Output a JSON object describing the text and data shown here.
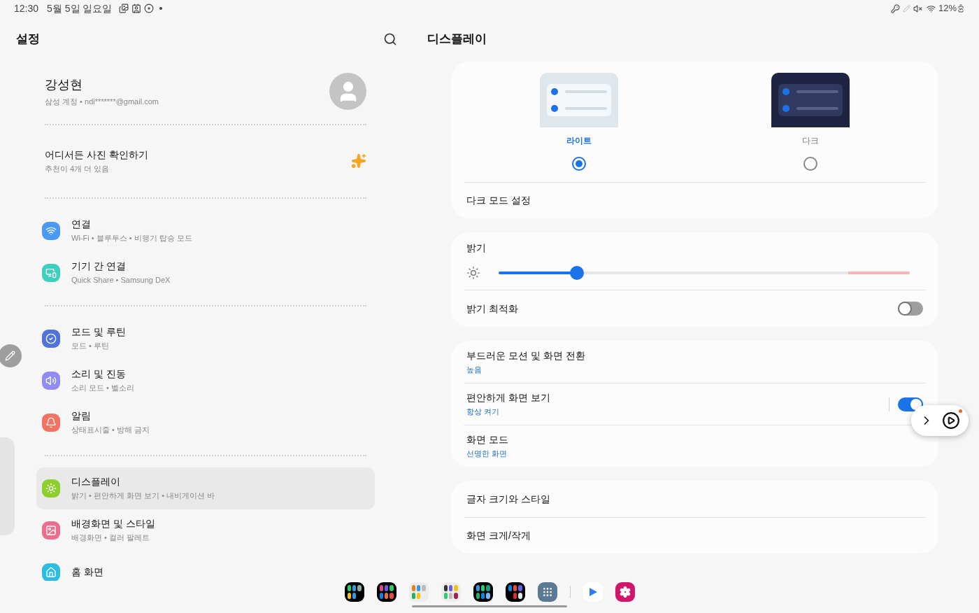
{
  "status_bar": {
    "time": "12:30",
    "date": "5월 5일 일요일",
    "battery": "12%"
  },
  "settings": {
    "title": "설정",
    "account": {
      "name": "강성현",
      "detail": "삼성 계정 • ndi*******@gmail.com"
    },
    "suggestion": {
      "title": "어디서든 사진 확인하기",
      "subtitle": "추천이 4개 더 있음"
    },
    "groups": [
      [
        {
          "title": "연결",
          "subtitle": "Wi-Fi • 블루투스 • 비행기 탑승 모드",
          "color": "#4a9af5",
          "selected": false
        },
        {
          "title": "기기 간 연결",
          "subtitle": "Quick Share • Samsung DeX",
          "color": "#3fcfc0",
          "selected": false
        }
      ],
      [
        {
          "title": "모드 및 루틴",
          "subtitle": "모드 • 루틴",
          "color": "#4f72dd",
          "selected": false
        },
        {
          "title": "소리 및 진동",
          "subtitle": "소리 모드 • 벨소리",
          "color": "#8f8cf4",
          "selected": false
        },
        {
          "title": "알림",
          "subtitle": "상태표시줄 • 방해 금지",
          "color": "#f27362",
          "selected": false
        }
      ],
      [
        {
          "title": "디스플레이",
          "subtitle": "밝기 • 편안하게 화면 보기 • 내비게이션 바",
          "color": "#8ccf2f",
          "selected": true
        },
        {
          "title": "배경화면 및 스타일",
          "subtitle": "배경화면 • 컬러 팔레트",
          "color": "#ee6c8d",
          "selected": false
        },
        {
          "title": "홈 화면",
          "color": "#2cbde0",
          "selected": false
        }
      ]
    ]
  },
  "display": {
    "title": "디스플레이",
    "themes": [
      {
        "label": "라이트",
        "kind": "light",
        "selected": true
      },
      {
        "label": "다크",
        "kind": "dark",
        "selected": false
      }
    ],
    "dark_mode_setting": "다크 모드 설정",
    "brightness": {
      "label": "밝기",
      "level": 0.19
    },
    "adaptive": {
      "label": "밝기 최적화",
      "on": false
    },
    "motion_items": [
      {
        "title": "부드러운 모션 및 화면 전환",
        "value": "높음",
        "kind": "plain"
      },
      {
        "title": "편안하게 화면 보기",
        "value": "항상 켜기",
        "kind": "toggle",
        "on": true
      },
      {
        "title": "화면 모드",
        "value": "선명한 화면",
        "kind": "plain"
      }
    ],
    "font_items": [
      {
        "title": "글자 크기와 스타일"
      },
      {
        "title": "화면 크게/작게"
      }
    ]
  }
}
